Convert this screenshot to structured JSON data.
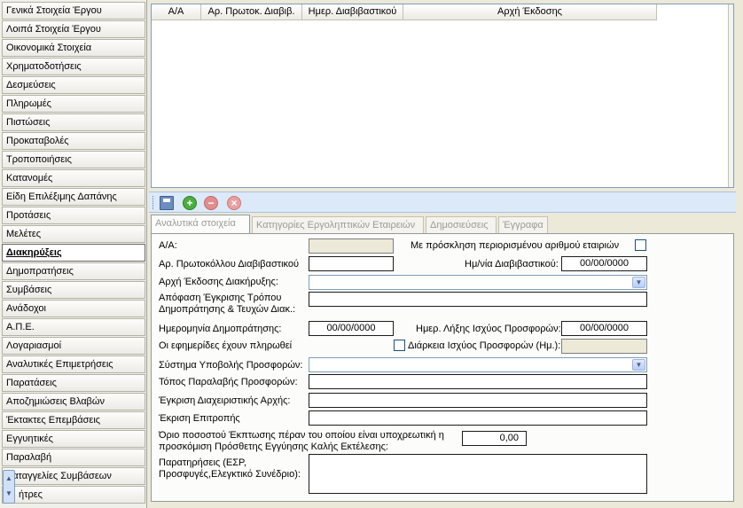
{
  "sidebar": {
    "items": [
      "Γενικά Στοιχεία Έργου",
      "Λοιπά Στοιχεία Έργου",
      "Οικονομικά Στοιχεία",
      "Χρηματοδοτήσεις",
      "Δεσμεύσεις",
      "Πληρωμές",
      "Πιστώσεις",
      "Προκαταβολές",
      "Τροποποιήσεις",
      "Κατανομές",
      "Είδη Επιλέξιμης Δαπάνης",
      "Προτάσεις",
      "Μελέτες",
      "Διακηρύξεις",
      "Δημοπρατήσεις",
      "Συμβάσεις",
      "Ανάδοχοι",
      "Α.Π.Ε.",
      "Λογαριασμοί",
      "Αναλυτικές Επιμετρήσεις",
      "Παρατάσεις",
      "Αποζημιώσεις Βλαβών",
      "Έκτακτες Επεμβάσεις",
      "Εγγυητικές",
      "Παραλαβή",
      "Καταγγελίες Συμβάσεων",
      "Ρήτρες"
    ],
    "active_index": 13,
    "last_item_visible": "ήτρες",
    "scroll_up": "▲",
    "scroll_down": "▼"
  },
  "grid": {
    "columns": [
      "Α/Α",
      "Αρ. Πρωτοκ. Διαβιβ.",
      "Ημερ. Διαβιβαστικού",
      "Αρχή Έκδοσης"
    ]
  },
  "toolbar": {
    "save_icon": "save-icon",
    "add_symbol": "+",
    "delete_symbol": "−",
    "cancel_symbol": "×"
  },
  "tabs": [
    "Αναλυτικά στοιχεία",
    "Κατηγορίες Εργοληπτικών Εταιρειών",
    "Δημοσιεύσεις",
    "Έγγραφα"
  ],
  "form": {
    "aa_label": "Α/Α:",
    "limited_label": "Με πρόσκληση περιορισμένου αριθμού εταιριών",
    "protocol_label": "Αρ. Πρωτοκόλλου Διαβιβαστικού",
    "date_label": "Ημ/νία Διαβιβαστικού:",
    "date_value": "00/00/0000",
    "authority_label": "Αρχή Έκδοσης Διακήρυξης:",
    "decision_label_1": "Απόφαση Έγκρισης Τρόπου",
    "decision_label_2": "Δημοπράτησης & Τευχών Διακ.:",
    "auction_date_label": "Ημερομηνία Δημοπράτησης:",
    "auction_date_value": "00/00/0000",
    "expiry_label": "Ημερ. Λήξης Ισχύος Προσφορών:",
    "expiry_value": "00/00/0000",
    "newspapers_label": "Οι εφημερίδες έχουν πληρωθεί",
    "duration_label": "Διάρκεια Ισχύος Προσφορών (Ημ.):",
    "system_label": "Σύστημα Υποβολής Προσφορών:",
    "place_label": "Τόπος Παραλαβής Προσφορών:",
    "approval_label": "Έγκριση Διαχειριστικής Αρχής:",
    "committee_label": "Έκριση Επιτροπής",
    "limit_label_1": "Όριο ποσοστού Έκπτωσης πέραν του οποίου είναι υποχρεωτική η",
    "limit_label_2": "προσκόμιση Πρόσθετης Εγγύησης Καλής Εκτέλεσης:",
    "limit_value": "0,00",
    "notes_label_1": "Παρατηρήσεις (ΕΣΡ,",
    "notes_label_2": "Προσφυγές,Ελεγκτικό Συνέδριο):"
  }
}
